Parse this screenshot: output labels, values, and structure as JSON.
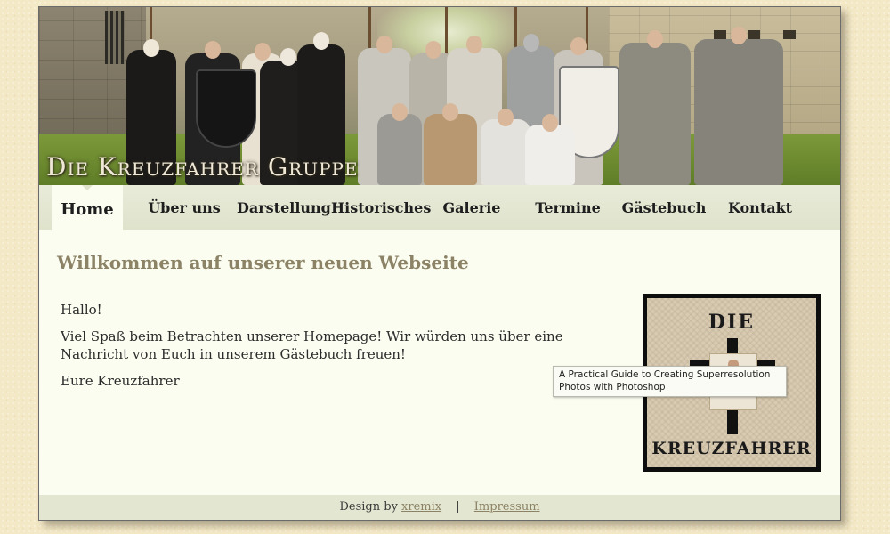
{
  "banner": {
    "title": "Die Kreuzfahrer Gruppe",
    "image_icon": "group-photo-image"
  },
  "nav": {
    "items": [
      {
        "label": "Home",
        "active": true
      },
      {
        "label": "Über uns",
        "active": false
      },
      {
        "label": "Darstellung",
        "active": false
      },
      {
        "label": "Historisches",
        "active": false
      },
      {
        "label": "Galerie",
        "active": false
      },
      {
        "label": "Termine",
        "active": false
      },
      {
        "label": "Gästebuch",
        "active": false
      },
      {
        "label": "Kontakt",
        "active": false
      }
    ]
  },
  "main": {
    "title": "Willkommen auf unserer neuen Webseite",
    "paragraphs": [
      "Hallo!",
      "Viel Spaß beim Betrachten unserer Homepage! Wir würden uns über eine Nachricht von Euch in unserem Gästebuch freuen!",
      "Eure Kreuzfahrer"
    ]
  },
  "logo": {
    "text_top": "DIE",
    "text_bottom": "KREUZFAHRER",
    "icon": "cross-logo-icon"
  },
  "tooltip": {
    "text": "A Practical Guide to Creating Superresolution Photos with Photoshop"
  },
  "footer": {
    "design_prefix": "Design by",
    "designer_link": "xremix",
    "separator": "|",
    "impressum_link": "Impressum"
  },
  "colors": {
    "background": "#f4e9c6",
    "page": "#fbfdf1",
    "nav_bg": "#dfe3cc",
    "title": "#8c8366",
    "link": "#8c8366"
  }
}
